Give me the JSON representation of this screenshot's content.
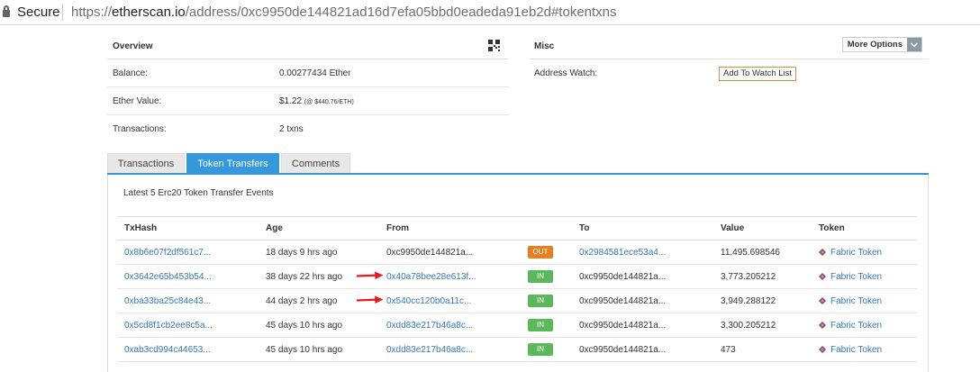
{
  "browser": {
    "secure_label": "Secure",
    "url_scheme": "https://",
    "url_domain": "etherscan.io",
    "url_path": "/address/0xc9950de144821ad16d7efa05bbd0eadeda91eb2d#tokentxns"
  },
  "overview": {
    "title": "Overview",
    "qr_icon": "qr-code-icon",
    "rows": [
      {
        "label": "Balance:",
        "value": "0.00277434 Ether"
      },
      {
        "label": "Ether Value:",
        "value": "$1.22",
        "value_note": "(@ $440.76/ETH)"
      },
      {
        "label": "Transactions:",
        "value": "2 txns"
      }
    ]
  },
  "misc": {
    "title": "Misc",
    "more_options_label": "More Options",
    "address_watch_label": "Address Watch:",
    "watch_button_label": "Add To Watch List"
  },
  "tabs": [
    {
      "label": "Transactions",
      "active": false
    },
    {
      "label": "Token Transfers",
      "active": true
    },
    {
      "label": "Comments",
      "active": false
    }
  ],
  "transfers": {
    "caption": "Latest 5 Erc20 Token Transfer Events",
    "columns": [
      "TxHash",
      "Age",
      "From",
      "",
      "To",
      "Value",
      "Token"
    ],
    "rows": [
      {
        "txhash": "0x8b6e07f2df561c7...",
        "age": "18 days 9 hrs ago",
        "from": "0xc9950de144821a...",
        "from_link": false,
        "direction": "OUT",
        "to": "0x2984581ece53a4...",
        "to_link": true,
        "value": "11,495.698546",
        "token": "Fabric Token",
        "arrow": false
      },
      {
        "txhash": "0x3642e65b453b54...",
        "age": "38 days 22 hrs ago",
        "from": "0x40a78bee28e613f...",
        "from_link": true,
        "direction": "IN",
        "to": "0xc9950de144821a...",
        "to_link": false,
        "value": "3,773.205212",
        "token": "Fabric Token",
        "arrow": true
      },
      {
        "txhash": "0xba33ba25c84e43...",
        "age": "44 days 2 hrs ago",
        "from": "0x540cc120b0a11c...",
        "from_link": true,
        "direction": "IN",
        "to": "0xc9950de144821a...",
        "to_link": false,
        "value": "3,949.288122",
        "token": "Fabric Token",
        "arrow": true
      },
      {
        "txhash": "0x5cd8f1cb2ee8c5a...",
        "age": "45 days 10 hrs ago",
        "from": "0xdd83e217b46a8c...",
        "from_link": true,
        "direction": "IN",
        "to": "0xc9950de144821a...",
        "to_link": false,
        "value": "3,300.205212",
        "token": "Fabric Token",
        "arrow": false
      },
      {
        "txhash": "0xab3cd994c44653...",
        "age": "45 days 10 hrs ago",
        "from": "0xdd83e217b46a8c...",
        "from_link": true,
        "direction": "IN",
        "to": "0xc9950de144821a...",
        "to_link": false,
        "value": "473",
        "token": "Fabric Token",
        "arrow": false
      }
    ]
  },
  "colors": {
    "accent": "#3498db",
    "link": "#3677b8",
    "out_badge": "#e67e22",
    "in_badge": "#5cb85c",
    "annotation_arrow": "#e8191d",
    "token_icon": "#8b4a5e"
  },
  "icons": {
    "lock": "lock-icon",
    "token": "fabric-token-icon",
    "dropdown": "chevron-down-icon",
    "annotation": "red-arrow-annotation"
  }
}
